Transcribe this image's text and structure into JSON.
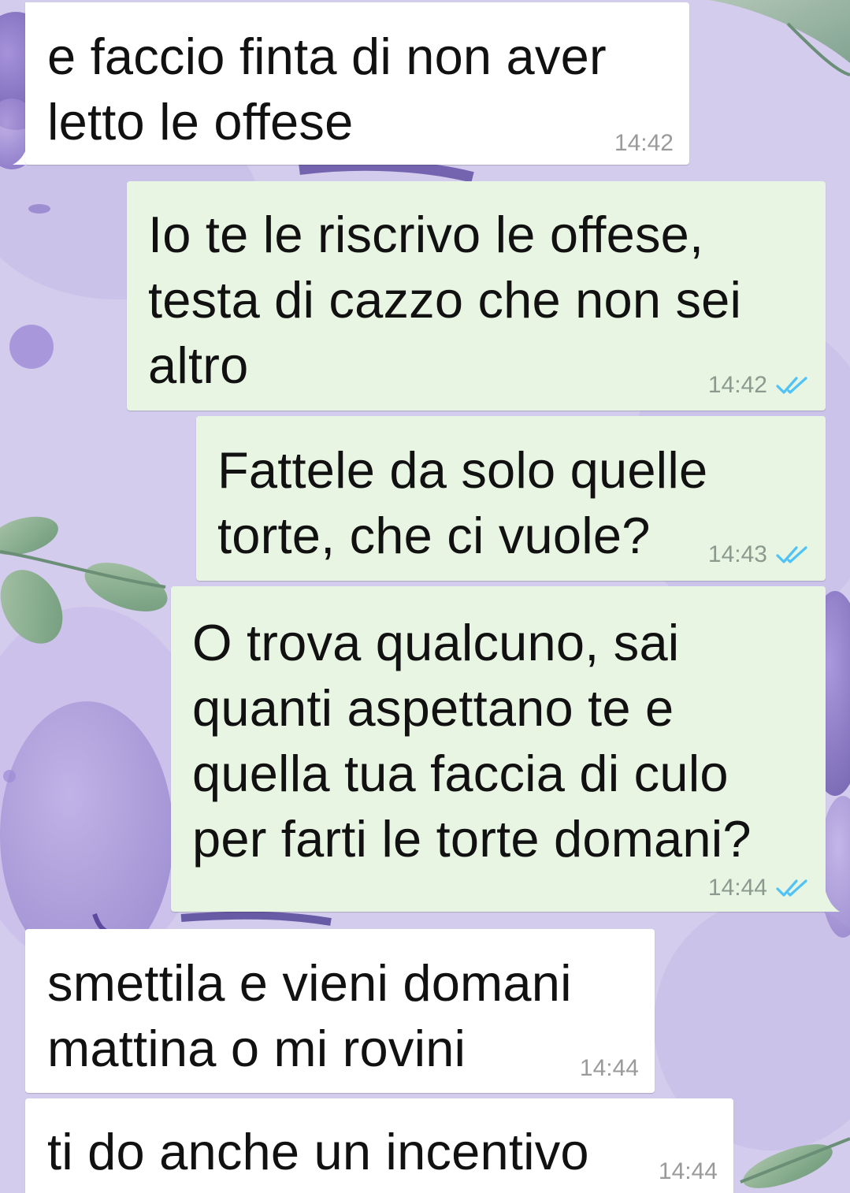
{
  "colors": {
    "incoming_bubble": "#ffffff",
    "outgoing_bubble": "#e8f5e2",
    "timestamp": "#8a9a8f",
    "read_ticks": "#4fc3f7",
    "wallpaper": "#d6cfee"
  },
  "messages": [
    {
      "direction": "in",
      "text": "e faccio finta di non aver\nletto le offese",
      "time": "14:42"
    },
    {
      "direction": "out",
      "text": "Io te le riscrivo le offese,\ntesta di cazzo che non sei\naltro",
      "time": "14:42",
      "status_icon": "double-check-icon"
    },
    {
      "direction": "out",
      "text": "Fattele da solo quelle\ntorte, che ci vuole?",
      "time": "14:43",
      "status_icon": "double-check-icon"
    },
    {
      "direction": "out",
      "text": "O trova qualcuno, sai\nquanti aspettano te e\nquella tua faccia di culo\nper farti le torte domani?",
      "time": "14:44",
      "status_icon": "double-check-icon"
    },
    {
      "direction": "in",
      "text": "smettila e vieni domani\nmattina o mi rovini",
      "time": "14:44"
    },
    {
      "direction": "in",
      "text": "ti do anche un incentivo",
      "time": "14:44"
    }
  ]
}
